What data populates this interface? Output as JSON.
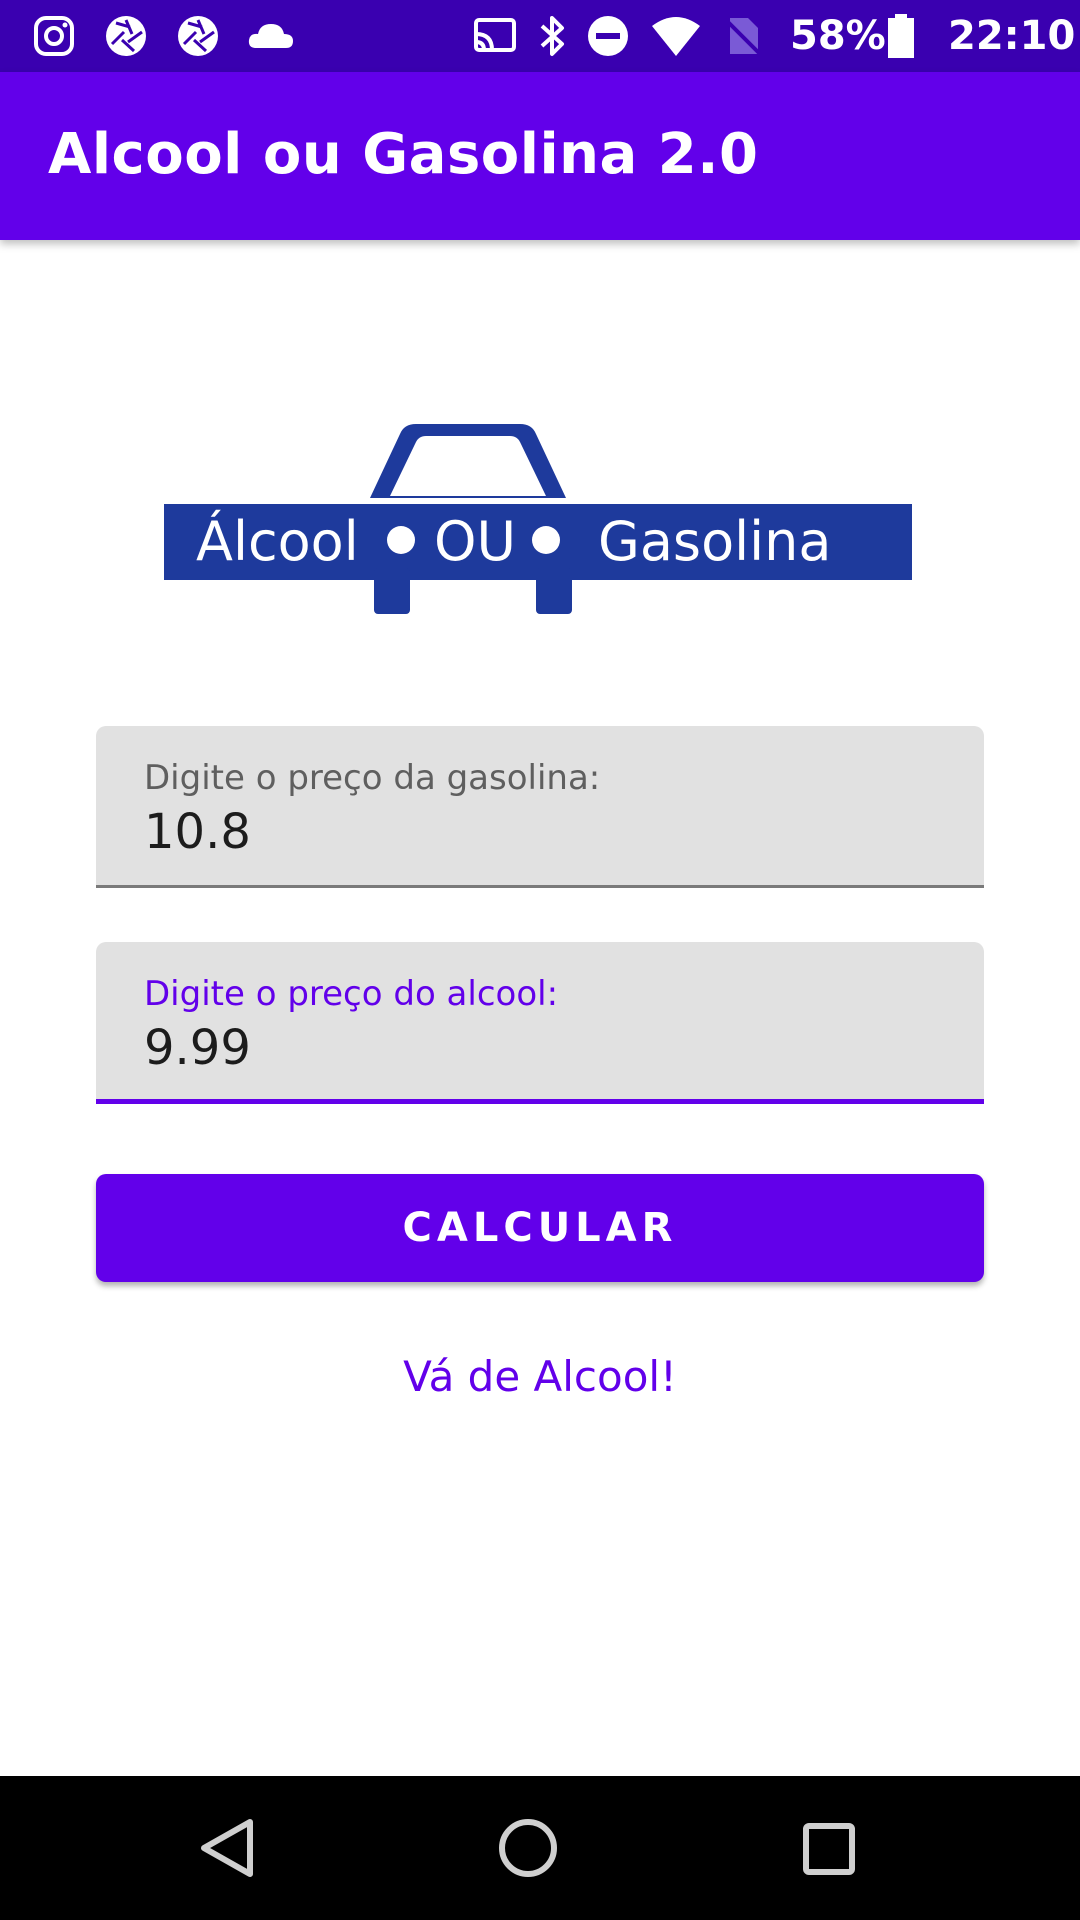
{
  "status_bar": {
    "icons": [
      "instagram-icon",
      "camera-shutter-icon",
      "camera-shutter-icon",
      "cloud-icon",
      "cast-icon",
      "bluetooth-icon",
      "do-not-disturb-icon",
      "wifi-icon",
      "no-sim-icon",
      "battery-icon"
    ],
    "battery_percent": "58%",
    "time": "22:10"
  },
  "app_bar": {
    "title": "Alcool ou Gasolina 2.0",
    "color": "#6200ea"
  },
  "logo": {
    "left_word": "Álcool",
    "middle_word": "OU",
    "right_word": "Gasolina",
    "color": "#1e3a9c"
  },
  "form": {
    "gasoline": {
      "label": "Digite o preço da gasolina:",
      "value": "10.8"
    },
    "alcohol": {
      "label": "Digite o preço do alcool:",
      "value": "9.99"
    },
    "button_label": "CALCULAR",
    "result": "Vá de Alcool!"
  },
  "colors": {
    "accent": "#6200ea",
    "status_bar": "#3a00b0",
    "field_bg": "#e1e1e1"
  },
  "nav_bar": {
    "buttons": [
      "back-icon",
      "home-icon",
      "recents-icon"
    ]
  }
}
